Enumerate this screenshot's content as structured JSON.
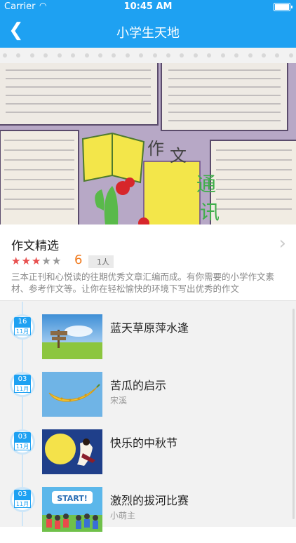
{
  "status_bar": {
    "carrier": "Carrier",
    "time": "10:45 AM"
  },
  "nav": {
    "title": "小学生天地"
  },
  "summary": {
    "title": "作文精选",
    "rating": "6",
    "stars_filled": 3,
    "stars_total": 5,
    "people": "1人",
    "description": "三本正刊和心悦读的往期优秀文章汇编而成。有你需要的小学作文素材、参考作文等。让你在轻松愉快的环境下写出优秀的作文"
  },
  "articles": [
    {
      "day": "16",
      "month": "11月",
      "title": "蓝天草原萍水逢",
      "author": "",
      "thumb": "grass-sky-signpost"
    },
    {
      "day": "03",
      "month": "11月",
      "title": "苦瓜的启示",
      "author": "宋溪",
      "thumb": "yellow-bitter-melon"
    },
    {
      "day": "03",
      "month": "11月",
      "title": "快乐的中秋节",
      "author": "",
      "thumb": "moon-festival"
    },
    {
      "day": "03",
      "month": "11月",
      "title": "激烈的拔河比赛",
      "author": "小萌主",
      "thumb": "start-tug-of-war"
    }
  ],
  "colors": {
    "brand": "#1ea1f2",
    "rating": "#f07a1e",
    "star": "#e8504f"
  }
}
